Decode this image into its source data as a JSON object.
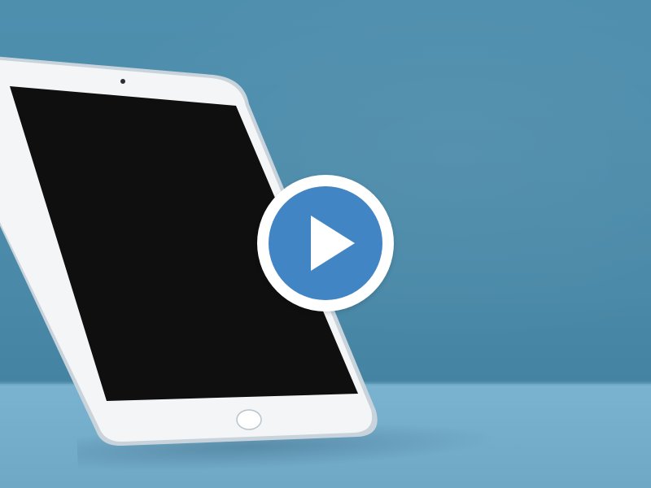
{
  "video": {
    "state": "paused",
    "play_icon": "play-icon",
    "accent_color": "#4285c4"
  },
  "scene": {
    "wall_color": "#4a89a8",
    "table_color": "#74afcb",
    "device": "tablet"
  }
}
